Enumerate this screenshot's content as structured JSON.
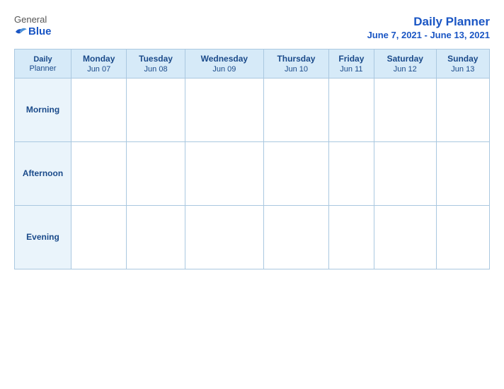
{
  "logo": {
    "general": "General",
    "blue": "Blue",
    "bird_symbol": "▶"
  },
  "title": {
    "main": "Daily Planner",
    "date_range": "June 7, 2021 - June 13, 2021"
  },
  "header_row": {
    "first_col_line1": "Daily",
    "first_col_line2": "Planner",
    "days": [
      {
        "name": "Monday",
        "date": "Jun 07"
      },
      {
        "name": "Tuesday",
        "date": "Jun 08"
      },
      {
        "name": "Wednesday",
        "date": "Jun 09"
      },
      {
        "name": "Thursday",
        "date": "Jun 10"
      },
      {
        "name": "Friday",
        "date": "Jun 11"
      },
      {
        "name": "Saturday",
        "date": "Jun 12"
      },
      {
        "name": "Sunday",
        "date": "Jun 13"
      }
    ]
  },
  "time_slots": [
    "Morning",
    "Afternoon",
    "Evening"
  ]
}
